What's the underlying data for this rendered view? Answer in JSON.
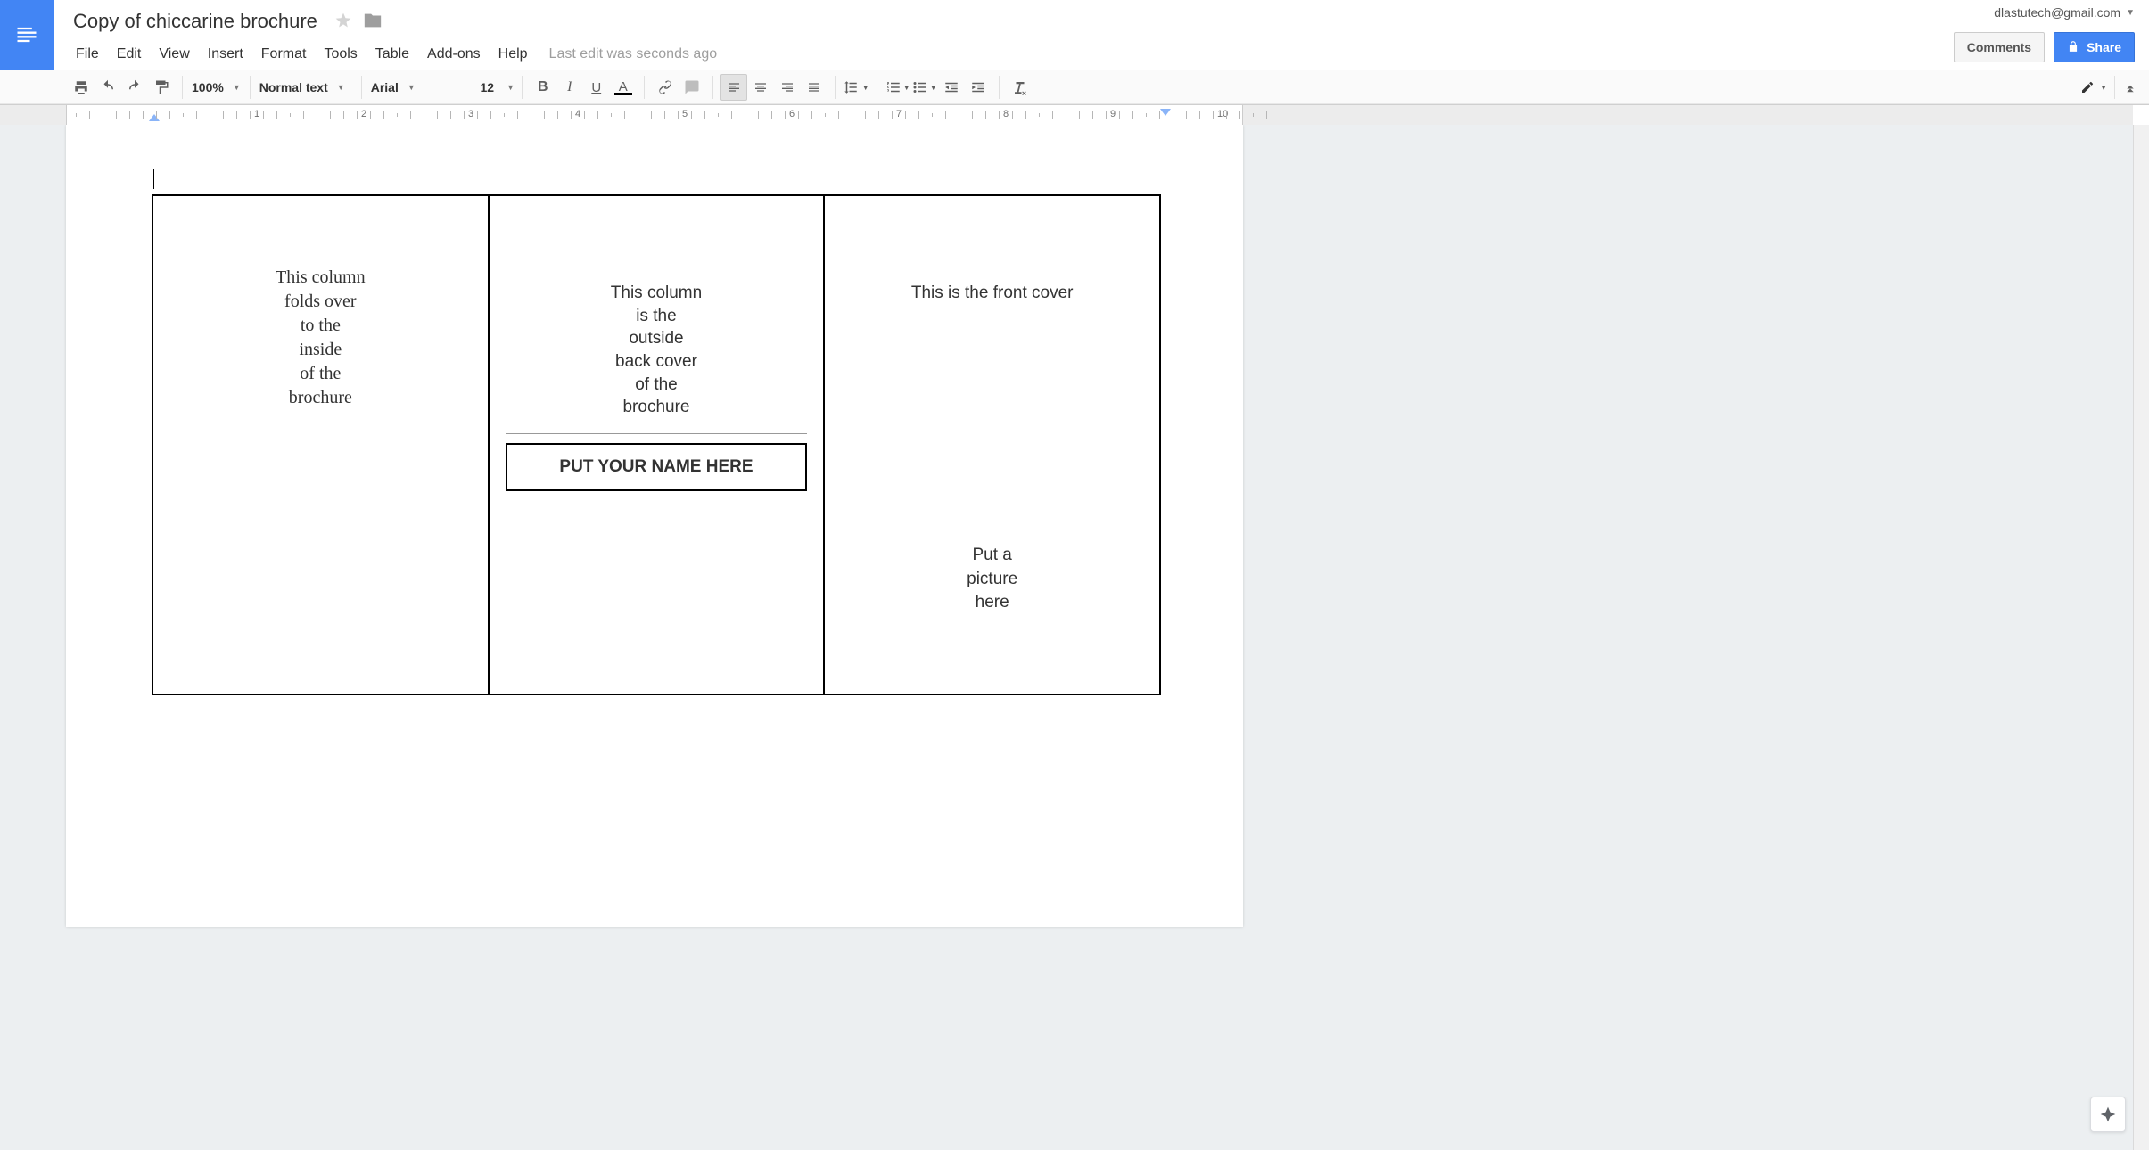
{
  "header": {
    "doc_title": "Copy of chiccarine brochure",
    "account_email": "dlastutech@gmail.com",
    "comments_label": "Comments",
    "share_label": "Share"
  },
  "menubar": {
    "items": [
      "File",
      "Edit",
      "View",
      "Insert",
      "Format",
      "Tools",
      "Table",
      "Add-ons",
      "Help"
    ],
    "last_edit": "Last edit was seconds ago"
  },
  "toolbar": {
    "zoom": "100%",
    "style": "Normal text",
    "font": "Arial",
    "font_size": "12"
  },
  "ruler": {
    "numbers": [
      "1",
      "2",
      "3",
      "4",
      "5",
      "6",
      "7",
      "8",
      "9",
      "10"
    ]
  },
  "document": {
    "col1": {
      "lines": [
        "This column",
        "folds over",
        "to the",
        "inside",
        "of the",
        "brochure"
      ]
    },
    "col2": {
      "lines": [
        "This column",
        "is the",
        "outside",
        "back cover",
        "of the",
        "brochure"
      ],
      "name_box": "PUT YOUR NAME HERE"
    },
    "col3": {
      "title": "This is the front cover",
      "picture_lines": [
        "Put a",
        "picture",
        "here"
      ]
    }
  }
}
